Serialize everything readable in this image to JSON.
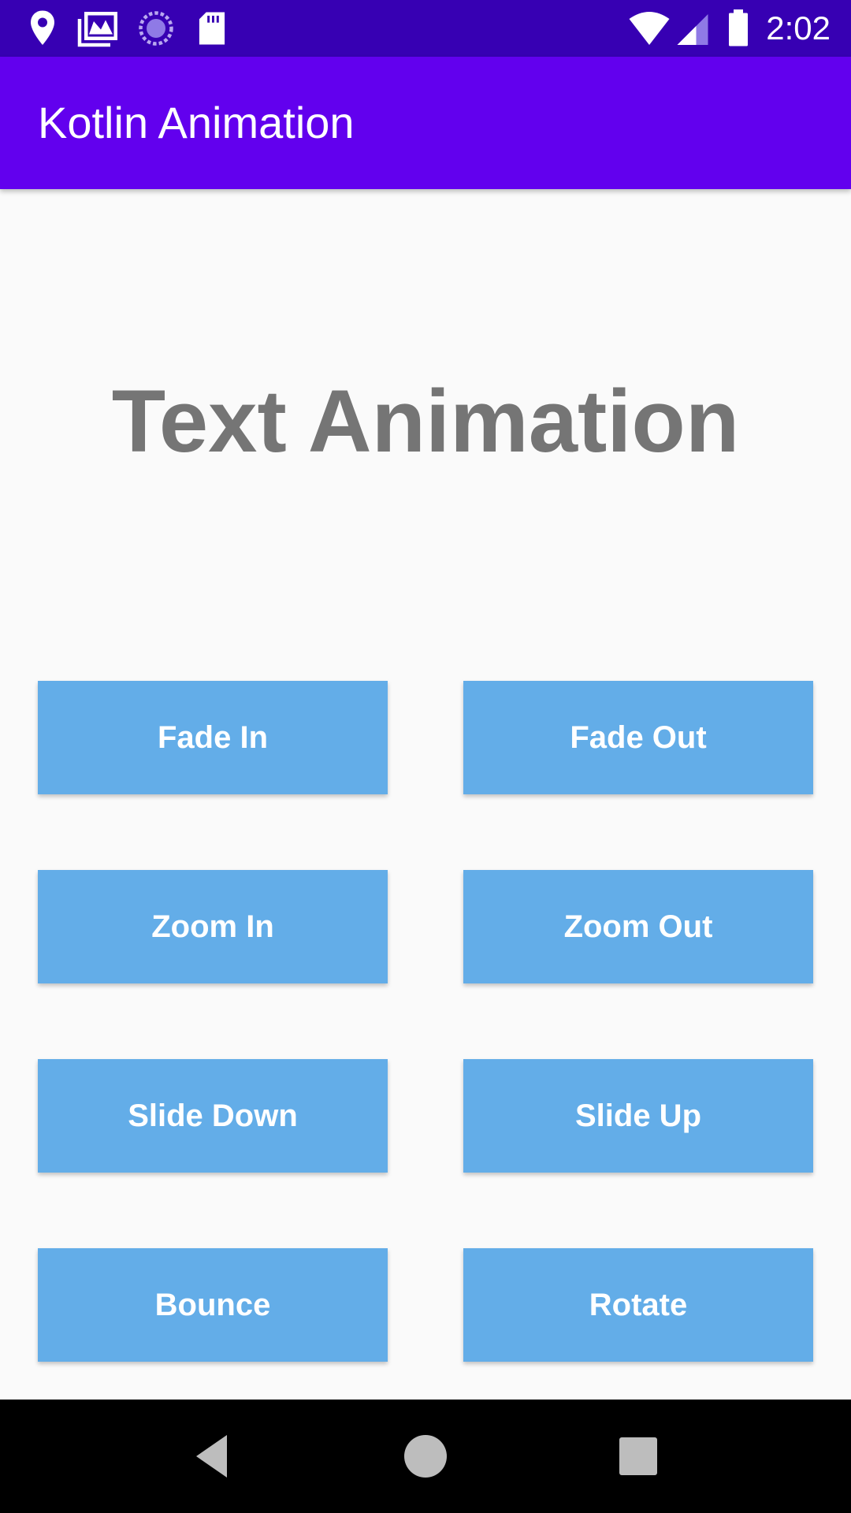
{
  "status_bar": {
    "time": "2:02",
    "left_icons": [
      "location-icon",
      "gallery-icon",
      "sync-icon",
      "sd-card-icon"
    ],
    "right_icons": [
      "wifi-icon",
      "signal-icon",
      "battery-icon"
    ]
  },
  "app_bar": {
    "title": "Kotlin Animation",
    "color": "#6200ee"
  },
  "main": {
    "headline": "Text Animation",
    "buttons": [
      {
        "label": "Fade In"
      },
      {
        "label": "Fade Out"
      },
      {
        "label": "Zoom In"
      },
      {
        "label": "Zoom Out"
      },
      {
        "label": "Slide Down"
      },
      {
        "label": "Slide Up"
      },
      {
        "label": "Bounce"
      },
      {
        "label": "Rotate"
      }
    ],
    "button_color": "#63ade8"
  },
  "nav_bar": {
    "buttons": [
      "back-icon",
      "home-icon",
      "recents-icon"
    ]
  }
}
